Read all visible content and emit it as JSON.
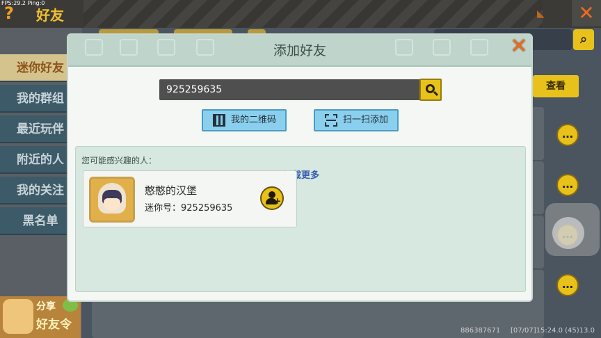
{
  "status": {
    "fps": "FPS:29.2",
    "ping": "Ping:0"
  },
  "app": {
    "help_icon": "question-icon",
    "title": "好友",
    "close_icon": "close-icon"
  },
  "sidebar": {
    "items": [
      {
        "label": "迷你好友",
        "active": true
      },
      {
        "label": "我的群组",
        "active": false
      },
      {
        "label": "最近玩伴",
        "active": false
      },
      {
        "label": "附近的人",
        "active": false
      },
      {
        "label": "我的关注",
        "active": false
      },
      {
        "label": "黑名单",
        "active": false
      }
    ],
    "share": {
      "line1": "分享",
      "line2": "好友令"
    }
  },
  "background": {
    "view_button": "查看",
    "bottom_id": "886387671",
    "bottom_time": "[07/07]15:24.0 (45)13.0"
  },
  "modal": {
    "title": "添加好友",
    "search": {
      "value": "925259635"
    },
    "buttons": {
      "qr_code": "我的二维码",
      "scan_add": "扫一扫添加"
    },
    "suggestions": {
      "heading": "您可能感兴趣的人：",
      "load_more": "加载更多",
      "people": [
        {
          "name": "憨憨的汉堡",
          "mini_id_label": "迷你号：925259635"
        }
      ]
    }
  },
  "colors": {
    "accent": "#e8c21a",
    "close": "#f06a1c",
    "active_tab": "#d5c38e",
    "button_blue": "#8ad0ee"
  }
}
